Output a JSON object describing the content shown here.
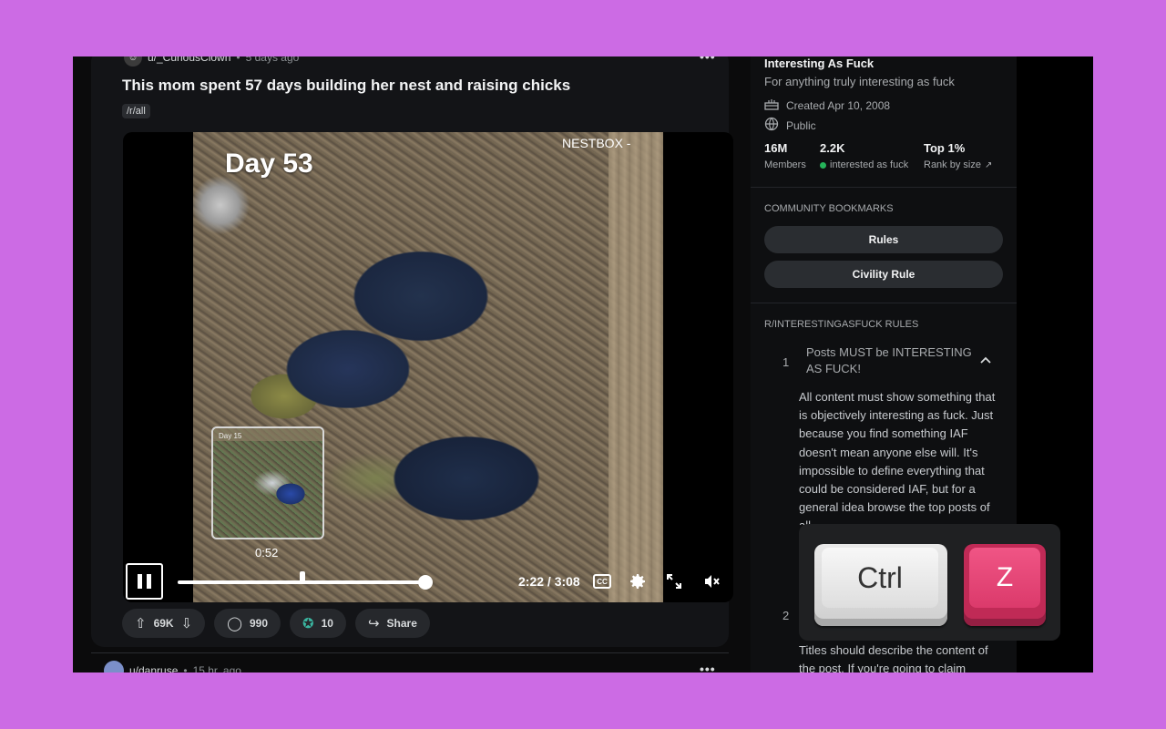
{
  "post": {
    "user": "u/_CuriousClown",
    "time": "5 days ago",
    "menu": "•••",
    "title": "This mom spent 57 days building her nest and raising chicks",
    "flair": "/r/all"
  },
  "video": {
    "overlay_day": "Day 53",
    "overlay_brand": "NESTBOX -",
    "thumb_day": "Day 15",
    "hover_time": "0:52",
    "current_time": "2:22",
    "duration": "3:08",
    "time_display": "2:22 / 3:08",
    "progress_fraction": 0.755,
    "hover_fraction": 0.38,
    "cc_label": "CC"
  },
  "actions": {
    "upvotes": "69K",
    "comments": "990",
    "awards": "10",
    "share": "Share"
  },
  "next_post": {
    "user": "u/danruse",
    "time": "15 hr. ago",
    "menu": "•••"
  },
  "sidebar": {
    "name": "Interesting As Fuck",
    "description": "For anything truly interesting as fuck",
    "created": "Created Apr 10, 2008",
    "visibility": "Public",
    "stats": [
      {
        "value": "16M",
        "label": "Members"
      },
      {
        "value": "2.2K",
        "label": "interested as fuck"
      },
      {
        "value": "Top 1%",
        "label": "Rank by size"
      }
    ],
    "bookmarks_heading": "COMMUNITY BOOKMARKS",
    "bookmarks": [
      "Rules",
      "Civility Rule"
    ],
    "rules_heading": "R/INTERESTINGASFUCK RULES",
    "rule1_num": "1",
    "rule1_title": "Posts MUST be INTERESTING AS FUCK!",
    "rule1_body": "All content must show something that is objectively interesting as fuck. Just because you find something IAF doesn't mean anyone else will. It's impossible to define everything that could be considered IAF, but for a general idea browse the top posts of all",
    "rule2_num": "2",
    "rule2_body": "Titles should describe the content of the post. If you're going to claim"
  },
  "keys": {
    "ctrl": "Ctrl",
    "z": "Z"
  }
}
